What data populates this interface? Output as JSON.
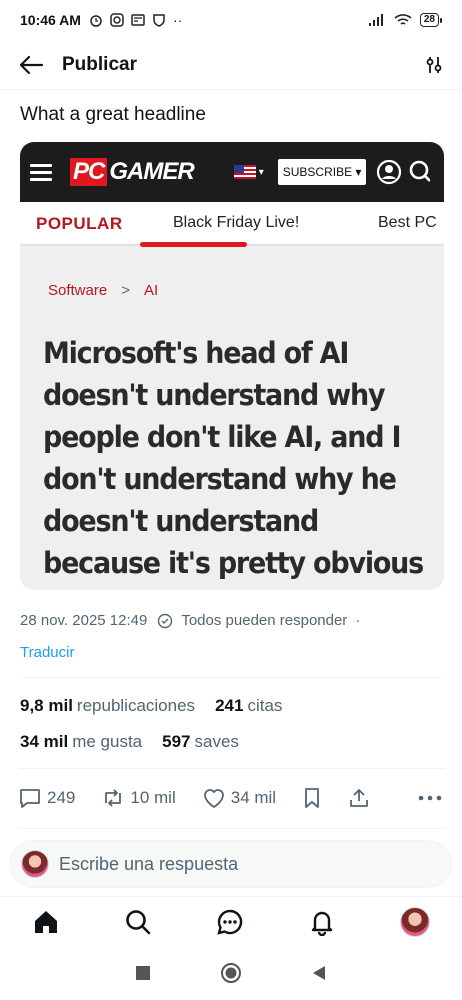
{
  "status_bar": {
    "time": "10:46 AM",
    "battery": "28"
  },
  "header": {
    "title": "Publicar"
  },
  "post": {
    "text": "What a great headline",
    "image": {
      "logo_pc": "PC",
      "logo_gamer": "GAMER",
      "subscribe": "SUBSCRIBE ▾",
      "tabs": [
        "POPULAR",
        "Black Friday Live!",
        "Best PC"
      ],
      "breadcrumb": [
        "Software",
        ">",
        "AI"
      ],
      "title_lines": [
        "Microsoft's head of AI",
        "doesn't understand why",
        "people don't like AI, and I",
        "don't understand why he",
        "doesn't understand",
        "because it's pretty obvious"
      ]
    },
    "date": "28 nov. 2025 12:49",
    "reply_setting": "Todos pueden responder",
    "dot": "·",
    "translate": "Traducir",
    "stats": {
      "reposts_count": "9,8 mil",
      "reposts_label": "republicaciones",
      "quotes_count": "241",
      "quotes_label": "citas",
      "likes_count": "34 mil",
      "likes_label": "me gusta",
      "saves_count": "597",
      "saves_label": "saves"
    },
    "actions": {
      "replies": "249",
      "reposts": "10 mil",
      "likes": "34 mil"
    }
  },
  "reply_box": {
    "placeholder": "Escribe una respuesta"
  },
  "colors": {
    "accent": "#1d9bf0",
    "pc_red": "#e0171e",
    "text_secondary": "#536471"
  },
  "icons": [
    "back-arrow-icon",
    "filter-icon",
    "comment-icon",
    "repost-icon",
    "heart-icon",
    "bookmark-icon",
    "share-icon",
    "more-icon",
    "home-icon",
    "search-icon",
    "messages-icon",
    "bell-icon"
  ]
}
